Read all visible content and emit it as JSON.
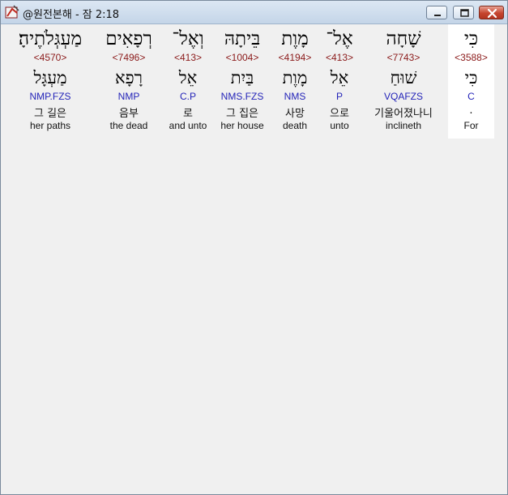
{
  "window": {
    "title": "@원전본해 - 잠 2:18"
  },
  "words": [
    {
      "hebrew": "מַעְגְּלֹתֶיהָ׃",
      "strong": "<4570>",
      "lemma": "מַעְגָּל",
      "parse": "NMP.FZS",
      "korean": "그 길은",
      "english": "her paths"
    },
    {
      "hebrew": "רְפָאִים",
      "strong": "<7496>",
      "lemma": "רָפָא",
      "parse": "NMP",
      "korean": "음부",
      "english": "the dead"
    },
    {
      "hebrew": "וְאֶל־",
      "strong": "<413>",
      "lemma": "אֵל",
      "parse": "C.P",
      "korean": "로",
      "english": "and unto"
    },
    {
      "hebrew": "בֵּיתָהּ",
      "strong": "<1004>",
      "lemma": "בַּיִת",
      "parse": "NMS.FZS",
      "korean": "그 집은",
      "english": "her house"
    },
    {
      "hebrew": "מָוֶת",
      "strong": "<4194>",
      "lemma": "מָוֶת",
      "parse": "NMS",
      "korean": "사망",
      "english": "death"
    },
    {
      "hebrew": "אֶל־",
      "strong": "<413>",
      "lemma": "אֵל",
      "parse": "P",
      "korean": "으로",
      "english": "unto"
    },
    {
      "hebrew": "שָׁחָה",
      "strong": "<7743>",
      "lemma": "שׁוּחַ",
      "parse": "VQAFZS",
      "korean": "기울어졌나니",
      "english": "inclineth"
    },
    {
      "hebrew": "כִּי",
      "strong": "<3588>",
      "lemma": "כִּי",
      "parse": "C",
      "korean": ".",
      "english": "For"
    }
  ]
}
